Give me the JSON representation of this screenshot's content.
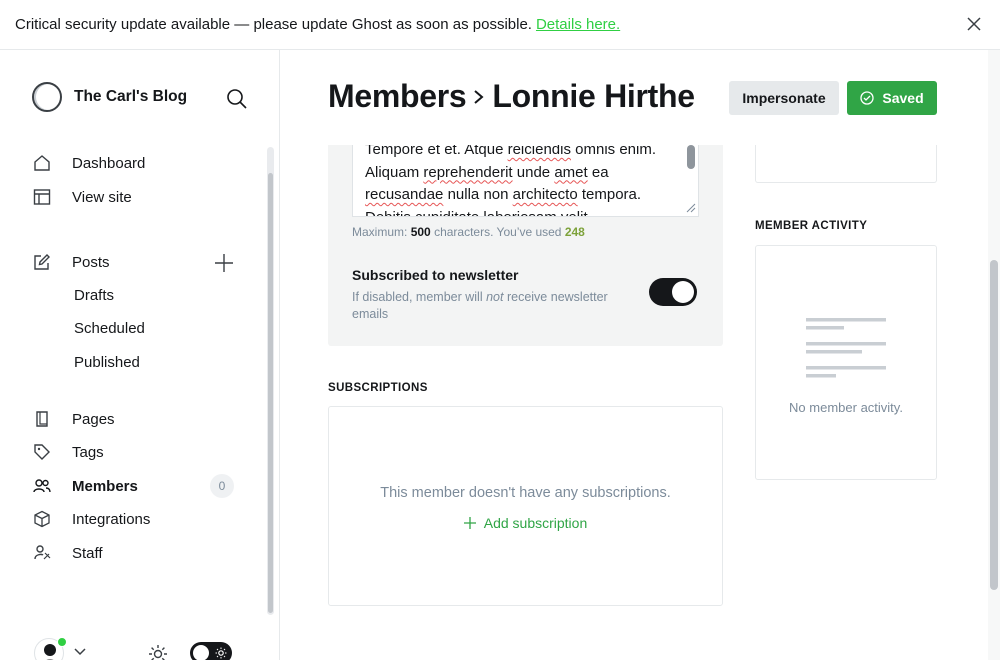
{
  "banner": {
    "message": "Critical security update available — please update Ghost as soon as possible.",
    "link": "Details here."
  },
  "sidebar": {
    "brand": "The Carl's Blog",
    "items": [
      {
        "label": "Dashboard",
        "icon": "home-icon"
      },
      {
        "label": "View site",
        "icon": "layout-icon"
      },
      {
        "label": "Posts",
        "icon": "edit-icon"
      },
      {
        "label": "Pages",
        "icon": "pages-icon"
      },
      {
        "label": "Tags",
        "icon": "tag-icon"
      },
      {
        "label": "Members",
        "icon": "members-icon",
        "count": "0"
      },
      {
        "label": "Integrations",
        "icon": "integrations-icon"
      },
      {
        "label": "Staff",
        "icon": "staff-icon"
      }
    ],
    "post_subitems": [
      "Drafts",
      "Scheduled",
      "Published"
    ]
  },
  "header": {
    "breadcrumb": "Members",
    "member_name": "Lonnie Hirthe",
    "impersonate": "Impersonate",
    "saved": "Saved"
  },
  "note": {
    "text_line1": "Tempore et et. Atque",
    "word_reiciendis": "reiciendis",
    "text_line1b": "omnis enim.",
    "text_line2a": "Aliquam",
    "word_reprehenderit": "reprehenderit",
    "text_line2b": "unde",
    "word_amet": "amet",
    "text_line2c": "ea",
    "word_recusandae": "recusandae",
    "text_line3a": "nulla non",
    "word_architecto": "architecto",
    "text_line3b": "tempora.",
    "text_line4": "Debitis cupiditate laboriosam velit",
    "hint_prefix": "Maximum:",
    "hint_max": "500",
    "hint_mid": "characters. You’ve used",
    "hint_used": "248"
  },
  "newsletter": {
    "label": "Subscribed to newsletter",
    "desc_a": "If disabled, member will",
    "desc_em": "not",
    "desc_b": "receive newsletter emails",
    "enabled": true
  },
  "subscriptions": {
    "title": "SUBSCRIPTIONS",
    "empty": "This member doesn't have any subscriptions.",
    "add": "Add subscription"
  },
  "activity": {
    "title": "MEMBER ACTIVITY",
    "empty": "No member activity."
  },
  "colors": {
    "accent": "#30cf43",
    "saved_button": "#30a546",
    "used_count": "#7da23a"
  }
}
